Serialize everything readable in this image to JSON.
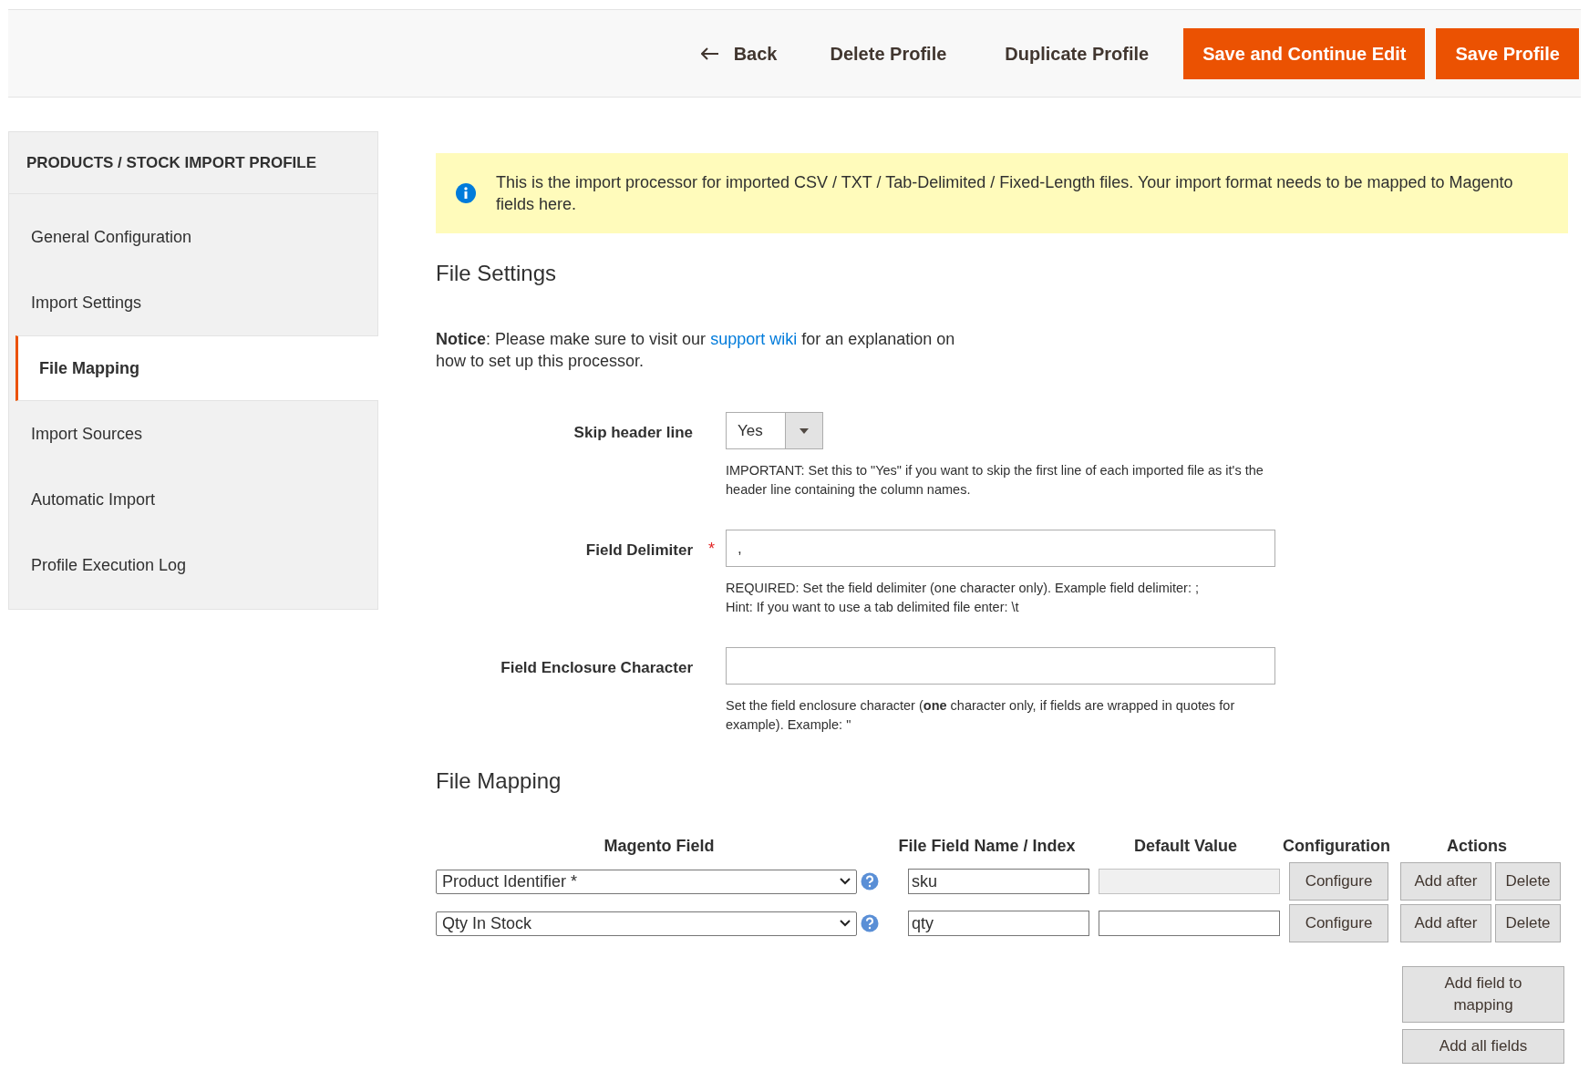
{
  "toolbar": {
    "back": "Back",
    "buttons": [
      {
        "label": "Delete Profile",
        "kind": "plain"
      },
      {
        "label": "Duplicate Profile",
        "kind": "plain"
      },
      {
        "label": "Save and Continue Edit",
        "kind": "primary"
      },
      {
        "label": "Save Profile",
        "kind": "primary"
      }
    ]
  },
  "sidebar": {
    "title": "PRODUCTS / STOCK IMPORT PROFILE",
    "items": [
      {
        "label": "General Configuration",
        "selected": false
      },
      {
        "label": "Import Settings",
        "selected": false
      },
      {
        "label": "File Mapping",
        "selected": true
      },
      {
        "label": "Import Sources",
        "selected": false
      },
      {
        "label": "Automatic Import",
        "selected": false
      },
      {
        "label": "Profile Execution Log",
        "selected": false
      }
    ]
  },
  "info_message": "This is the import processor for imported CSV / TXT / Tab-Delimited / Fixed-Length files. Your import format needs to be mapped to Magento fields here.",
  "file_settings": {
    "title": "File Settings",
    "notice": {
      "before": "**Notice**: Please make sure to visit our",
      "link": "support wiki",
      "after": "for an explanation on how to set up this processor."
    },
    "fields": [
      {
        "label": "Skip header line",
        "kind": "select",
        "value": "Yes",
        "note": "IMPORTANT: Set this to \"Yes\" if you want to skip the first line of each imported file as it's the header line containing the column names."
      },
      {
        "label": "Field Delimiter",
        "kind": "text",
        "value": ",",
        "required_mark": "*",
        "note": "REQUIRED: Set the field delimiter (one character only). Example field delimiter: ;\nHint: If you want to use a tab delimited file enter: \\t"
      },
      {
        "label": "Field Enclosure Character",
        "kind": "text",
        "note": "Set the field enclosure character (**one** character only, if fields are wrapped in quotes for example). Example: \""
      }
    ]
  },
  "file_mapping": {
    "title": "File Mapping",
    "columns": [
      "Magento Field",
      "File Field Name / Index",
      "Default Value",
      "Configuration",
      "Actions"
    ],
    "rows": [
      {
        "magento_field": "Product Identifier *",
        "file_field": "sku",
        "default_value": "",
        "default_disabled": true,
        "configure": "Configure",
        "add_after": "Add after",
        "delete": "Delete"
      },
      {
        "magento_field": "Qty In Stock",
        "file_field": "qty",
        "default_value": "",
        "default_disabled": false,
        "configure": "Configure",
        "add_after": "Add after",
        "delete": "Delete"
      }
    ],
    "buttons": [
      "Add field to mapping",
      "Add all fields"
    ]
  }
}
